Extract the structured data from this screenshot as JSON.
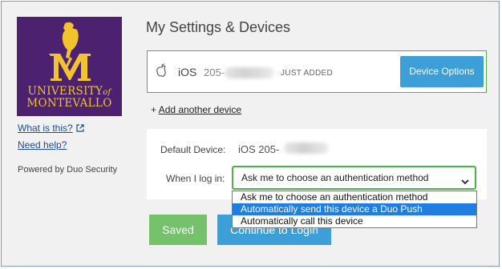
{
  "sidebar": {
    "logo": {
      "line1_a": "UNIVERSITY",
      "line1_of": "of",
      "line2": "MONTEVALLO",
      "monogram": "M",
      "bg_color": "#4b2170",
      "fg_color": "#f3c22f"
    },
    "what_is_this": "What is this?",
    "need_help": "Need help?",
    "powered_by": "Powered by Duo Security"
  },
  "main": {
    "title": "My Settings & Devices",
    "device": {
      "icon": "apple-icon",
      "name": "iOS",
      "number_prefix": "205-",
      "badge": "JUST ADDED",
      "options_button": "Device Options"
    },
    "add_device": {
      "plus": "+",
      "label": "Add another device"
    },
    "settings": {
      "default_device_label": "Default Device:",
      "default_device_value": "iOS 205-",
      "when_login_label": "When I log in:",
      "selected_option": "Ask me to choose an authentication method",
      "options": [
        "Ask me to choose an authentication method",
        "Automatically send this device a Duo Push",
        "Automatically call this device"
      ],
      "highlighted_index": 1
    },
    "buttons": {
      "saved": "Saved",
      "continue": "Continue to Login"
    },
    "colors": {
      "accent_blue": "#3d9fd8",
      "success_green": "#4db04a",
      "saved_green": "#76c26c",
      "highlight_blue": "#1e7fe0"
    }
  }
}
